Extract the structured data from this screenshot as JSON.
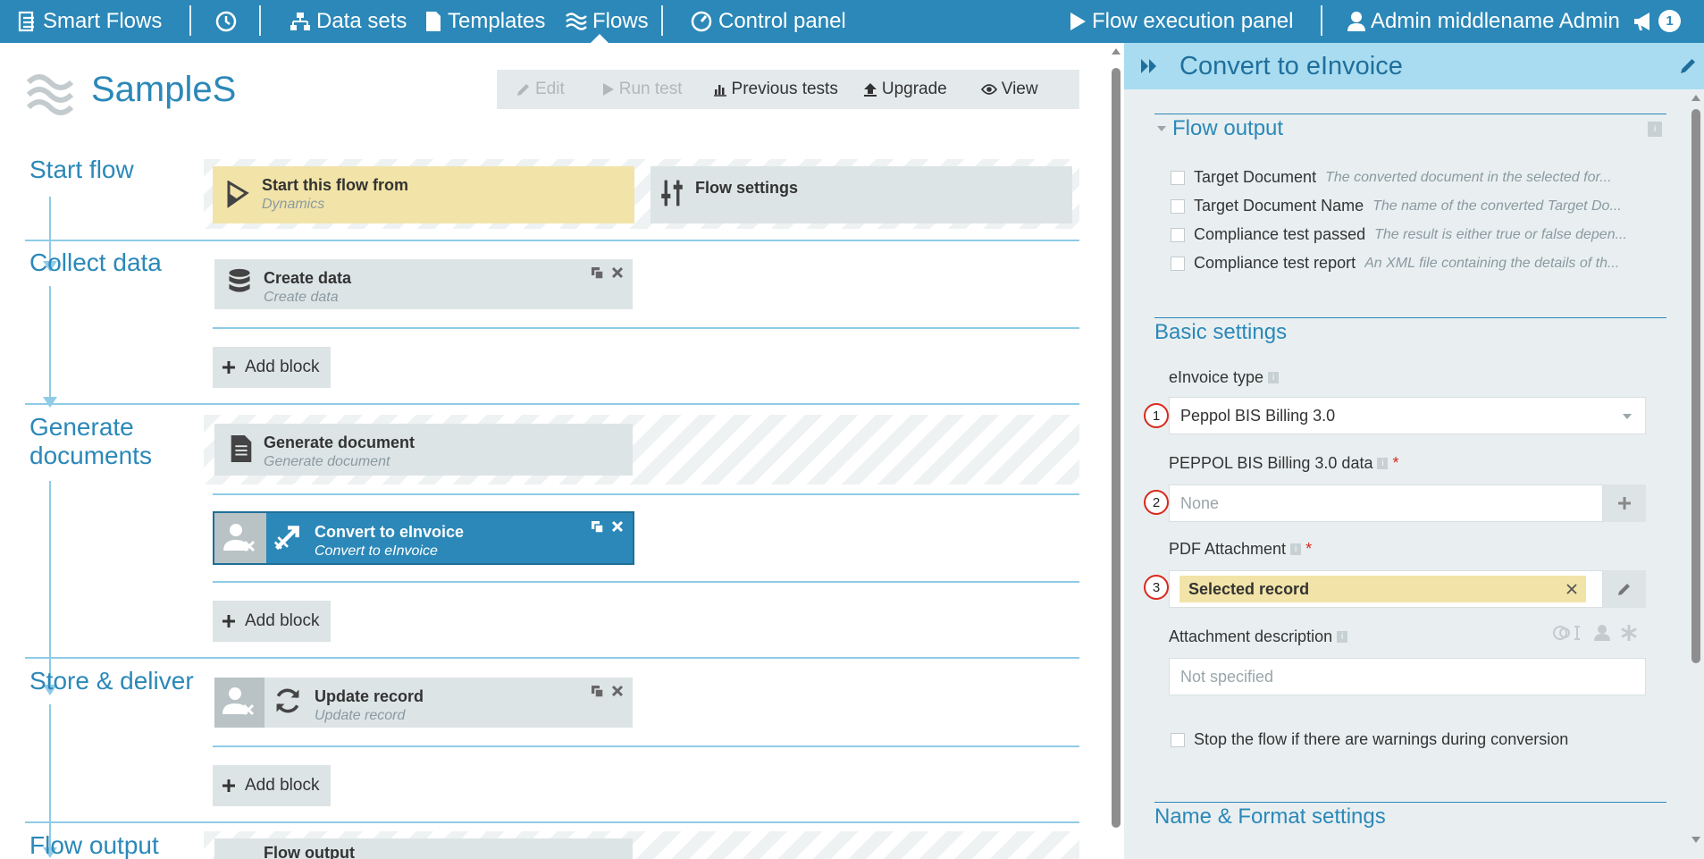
{
  "nav": {
    "app": "Smart Flows",
    "items": [
      "Data sets",
      "Templates",
      "Flows",
      "Control panel"
    ],
    "execution_panel": "Flow execution panel",
    "user": "Admin middlename Admin",
    "notifications": "1"
  },
  "flow": {
    "title": "SampleS",
    "toolbar": {
      "edit": "Edit",
      "run_test": "Run test",
      "previous_tests": "Previous tests",
      "upgrade": "Upgrade",
      "view": "View"
    },
    "add_block": "Add block",
    "sections": {
      "start": "Start flow",
      "collect": "Collect data",
      "generate": "Generate documents",
      "store": "Store & deliver",
      "output": "Flow output"
    },
    "blocks": {
      "start_from": {
        "title": "Start this flow from",
        "sub": "Dynamics"
      },
      "settings": {
        "title": "Flow settings"
      },
      "create_data": {
        "title": "Create data",
        "sub": "Create data"
      },
      "generate_doc": {
        "title": "Generate document",
        "sub": "Generate document"
      },
      "convert": {
        "title": "Convert to eInvoice",
        "sub": "Convert to eInvoice"
      },
      "update": {
        "title": "Update record",
        "sub": "Update record"
      },
      "flow_output": {
        "title": "Flow output"
      }
    }
  },
  "panel": {
    "title": "Convert to eInvoice",
    "flow_output": {
      "heading": "Flow output",
      "items": [
        {
          "label": "Target Document",
          "desc": "The converted document in the selected for..."
        },
        {
          "label": "Target Document Name",
          "desc": "The name of the converted Target Do..."
        },
        {
          "label": "Compliance test passed",
          "desc": "The result is either true or false depen..."
        },
        {
          "label": "Compliance test report",
          "desc": "An XML file containing the details of th..."
        }
      ]
    },
    "basic": {
      "heading": "Basic settings",
      "einvoice_type_label": "eInvoice type",
      "einvoice_type_value": "Peppol BIS Billing 3.0",
      "peppol_label": "PEPPOL BIS Billing 3.0 data",
      "peppol_placeholder": "None",
      "pdf_label": "PDF Attachment",
      "pdf_value": "Selected record",
      "desc_label": "Attachment description",
      "desc_placeholder": "Not specified",
      "stop_label": "Stop the flow if there are warnings during conversion",
      "markers": [
        "1",
        "2",
        "3"
      ],
      "required_mark": "*"
    },
    "name_format": {
      "heading": "Name & Format settings"
    }
  },
  "colors": {
    "brand": "#2b88b8",
    "panel_header": "#a9dcf0",
    "start_block": "#f2e4a8",
    "required": "#d9291c"
  }
}
